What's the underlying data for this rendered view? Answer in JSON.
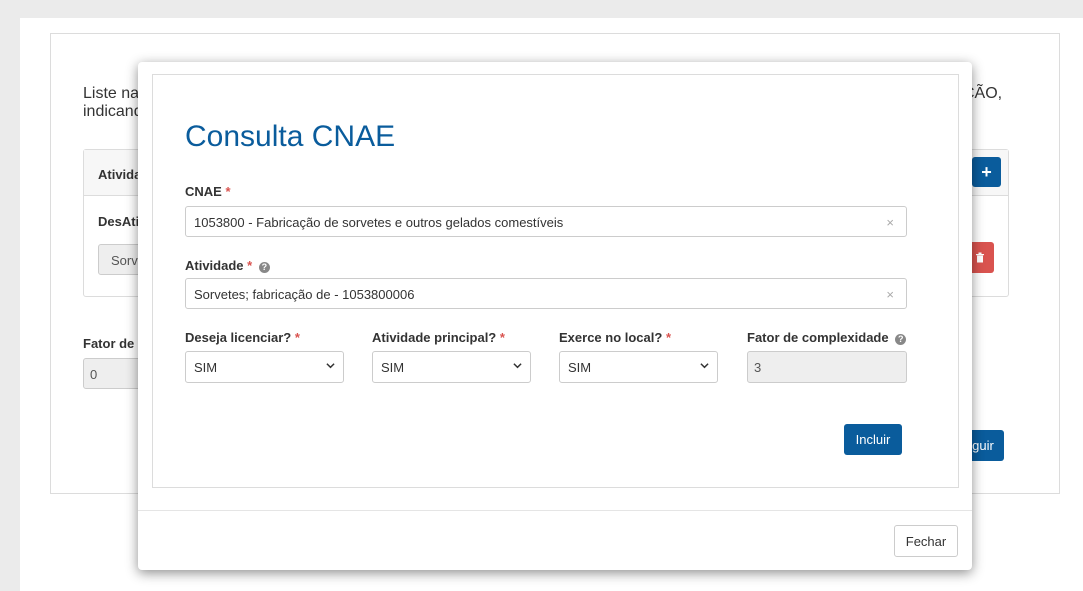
{
  "background": {
    "intro_left_line1": "Liste na",
    "intro_left_line2": "indicand",
    "intro_right": "ÇÃO,",
    "panel_header": "Ativida",
    "panel_label": "DesAti",
    "panel_input": "Sorve",
    "fator_label": "Fator de",
    "fator_value": "0",
    "next_button": "guir",
    "add_button": "+"
  },
  "modal": {
    "title": "Consulta CNAE",
    "cnae": {
      "label": "CNAE",
      "required": "*",
      "value": "1053800 - Fabricação de sorvetes e outros gelados comestíveis",
      "clear_icon": "×"
    },
    "atividade": {
      "label": "Atividade",
      "required": "*",
      "help_icon": "?",
      "value": "Sorvetes; fabricação de - 1053800006",
      "clear_icon": "×"
    },
    "deseja_licenciar": {
      "label": "Deseja licenciar?",
      "required": "*",
      "value": "SIM"
    },
    "atividade_principal": {
      "label": "Atividade principal?",
      "required": "*",
      "value": "SIM"
    },
    "exerce_local": {
      "label": "Exerce no local?",
      "required": "*",
      "value": "SIM"
    },
    "fator_complexidade": {
      "label": "Fator de complexidade",
      "help_icon": "?",
      "value": "3"
    },
    "incluir_button": "Incluir",
    "fechar_button": "Fechar"
  },
  "colors": {
    "primary": "#0a5c9c",
    "danger": "#d9534f",
    "overlay": "#ebebeb"
  }
}
